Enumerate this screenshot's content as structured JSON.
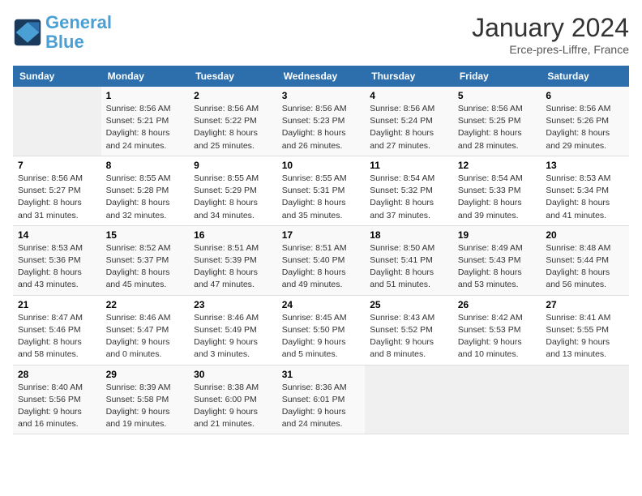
{
  "header": {
    "logo_line1": "General",
    "logo_line2": "Blue",
    "month_title": "January 2024",
    "subtitle": "Erce-pres-Liffre, France"
  },
  "days_of_week": [
    "Sunday",
    "Monday",
    "Tuesday",
    "Wednesday",
    "Thursday",
    "Friday",
    "Saturday"
  ],
  "weeks": [
    [
      {
        "day": "",
        "info": ""
      },
      {
        "day": "1",
        "info": "Sunrise: 8:56 AM\nSunset: 5:21 PM\nDaylight: 8 hours\nand 24 minutes."
      },
      {
        "day": "2",
        "info": "Sunrise: 8:56 AM\nSunset: 5:22 PM\nDaylight: 8 hours\nand 25 minutes."
      },
      {
        "day": "3",
        "info": "Sunrise: 8:56 AM\nSunset: 5:23 PM\nDaylight: 8 hours\nand 26 minutes."
      },
      {
        "day": "4",
        "info": "Sunrise: 8:56 AM\nSunset: 5:24 PM\nDaylight: 8 hours\nand 27 minutes."
      },
      {
        "day": "5",
        "info": "Sunrise: 8:56 AM\nSunset: 5:25 PM\nDaylight: 8 hours\nand 28 minutes."
      },
      {
        "day": "6",
        "info": "Sunrise: 8:56 AM\nSunset: 5:26 PM\nDaylight: 8 hours\nand 29 minutes."
      }
    ],
    [
      {
        "day": "7",
        "info": "Sunrise: 8:56 AM\nSunset: 5:27 PM\nDaylight: 8 hours\nand 31 minutes."
      },
      {
        "day": "8",
        "info": "Sunrise: 8:55 AM\nSunset: 5:28 PM\nDaylight: 8 hours\nand 32 minutes."
      },
      {
        "day": "9",
        "info": "Sunrise: 8:55 AM\nSunset: 5:29 PM\nDaylight: 8 hours\nand 34 minutes."
      },
      {
        "day": "10",
        "info": "Sunrise: 8:55 AM\nSunset: 5:31 PM\nDaylight: 8 hours\nand 35 minutes."
      },
      {
        "day": "11",
        "info": "Sunrise: 8:54 AM\nSunset: 5:32 PM\nDaylight: 8 hours\nand 37 minutes."
      },
      {
        "day": "12",
        "info": "Sunrise: 8:54 AM\nSunset: 5:33 PM\nDaylight: 8 hours\nand 39 minutes."
      },
      {
        "day": "13",
        "info": "Sunrise: 8:53 AM\nSunset: 5:34 PM\nDaylight: 8 hours\nand 41 minutes."
      }
    ],
    [
      {
        "day": "14",
        "info": "Sunrise: 8:53 AM\nSunset: 5:36 PM\nDaylight: 8 hours\nand 43 minutes."
      },
      {
        "day": "15",
        "info": "Sunrise: 8:52 AM\nSunset: 5:37 PM\nDaylight: 8 hours\nand 45 minutes."
      },
      {
        "day": "16",
        "info": "Sunrise: 8:51 AM\nSunset: 5:39 PM\nDaylight: 8 hours\nand 47 minutes."
      },
      {
        "day": "17",
        "info": "Sunrise: 8:51 AM\nSunset: 5:40 PM\nDaylight: 8 hours\nand 49 minutes."
      },
      {
        "day": "18",
        "info": "Sunrise: 8:50 AM\nSunset: 5:41 PM\nDaylight: 8 hours\nand 51 minutes."
      },
      {
        "day": "19",
        "info": "Sunrise: 8:49 AM\nSunset: 5:43 PM\nDaylight: 8 hours\nand 53 minutes."
      },
      {
        "day": "20",
        "info": "Sunrise: 8:48 AM\nSunset: 5:44 PM\nDaylight: 8 hours\nand 56 minutes."
      }
    ],
    [
      {
        "day": "21",
        "info": "Sunrise: 8:47 AM\nSunset: 5:46 PM\nDaylight: 8 hours\nand 58 minutes."
      },
      {
        "day": "22",
        "info": "Sunrise: 8:46 AM\nSunset: 5:47 PM\nDaylight: 9 hours\nand 0 minutes."
      },
      {
        "day": "23",
        "info": "Sunrise: 8:46 AM\nSunset: 5:49 PM\nDaylight: 9 hours\nand 3 minutes."
      },
      {
        "day": "24",
        "info": "Sunrise: 8:45 AM\nSunset: 5:50 PM\nDaylight: 9 hours\nand 5 minutes."
      },
      {
        "day": "25",
        "info": "Sunrise: 8:43 AM\nSunset: 5:52 PM\nDaylight: 9 hours\nand 8 minutes."
      },
      {
        "day": "26",
        "info": "Sunrise: 8:42 AM\nSunset: 5:53 PM\nDaylight: 9 hours\nand 10 minutes."
      },
      {
        "day": "27",
        "info": "Sunrise: 8:41 AM\nSunset: 5:55 PM\nDaylight: 9 hours\nand 13 minutes."
      }
    ],
    [
      {
        "day": "28",
        "info": "Sunrise: 8:40 AM\nSunset: 5:56 PM\nDaylight: 9 hours\nand 16 minutes."
      },
      {
        "day": "29",
        "info": "Sunrise: 8:39 AM\nSunset: 5:58 PM\nDaylight: 9 hours\nand 19 minutes."
      },
      {
        "day": "30",
        "info": "Sunrise: 8:38 AM\nSunset: 6:00 PM\nDaylight: 9 hours\nand 21 minutes."
      },
      {
        "day": "31",
        "info": "Sunrise: 8:36 AM\nSunset: 6:01 PM\nDaylight: 9 hours\nand 24 minutes."
      },
      {
        "day": "",
        "info": ""
      },
      {
        "day": "",
        "info": ""
      },
      {
        "day": "",
        "info": ""
      }
    ]
  ]
}
